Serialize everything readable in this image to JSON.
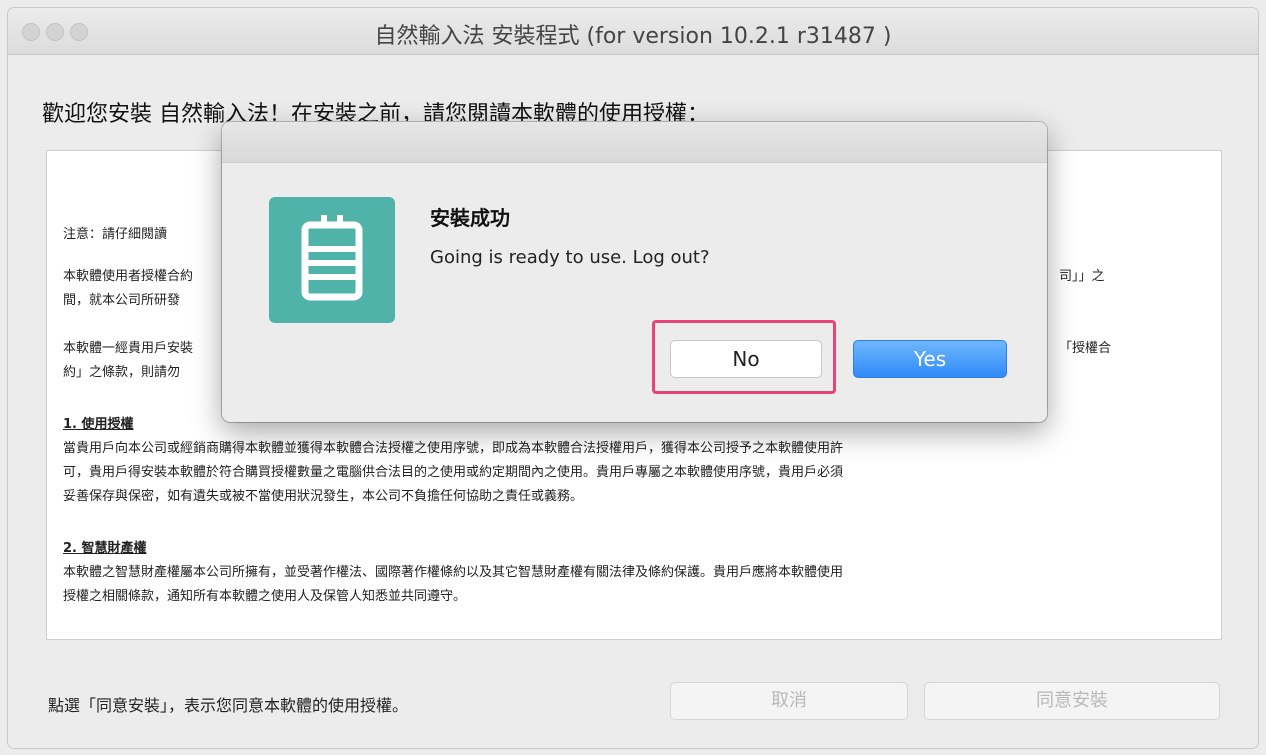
{
  "window": {
    "title": "自然輸入法 安裝程式 (for version 10.2.1 r31487 )"
  },
  "welcome": "歡迎您安裝 自然輸入法！在安裝之前，請您閱讀本軟體的使用授權：",
  "license": {
    "notice": "注意：請仔細閱讀",
    "para1_line1": "本軟體使用者授權合約",
    "para1_right": "司」」之",
    "para1_line2": "間，就本公司所研發",
    "para2_line1": "本軟體一經貴用戶安裝",
    "para2_right": "「授權合",
    "para2_line2": "約」之條款，則請勿",
    "section1_title": "1. 使用授權",
    "section1_line1": "當貴用戶向本公司或經銷商購得本軟體並獲得本軟體合法授權之使用序號，即成為本軟體合法授權用戶，獲得本公司授予之本軟體使用許",
    "section1_line2": "可，貴用戶得安裝本軟體於符合購買授權數量之電腦供合法目的之使用或約定期間內之使用。貴用戶專屬之本軟體使用序號，貴用戶必須",
    "section1_line3": "妥善保存與保密，如有遺失或被不當使用狀況發生，本公司不負擔任何協助之責任或義務。",
    "section2_title": "2. 智慧財產權",
    "section2_line1": "本軟體之智慧財產權屬本公司所擁有，並受著作權法、國際著作權條約以及其它智慧財產權有關法律及條約保護。貴用戶應將本軟體使用",
    "section2_line2": "授權之相關條款，通知所有本軟體之使用人及保管人知悉並共同遵守。"
  },
  "bottom": {
    "agree_text": "點選「同意安裝」，表示您同意本軟體的使用授權。",
    "cancel_label": "取消",
    "agree_label": "同意安裝"
  },
  "dialog": {
    "title": "安裝成功",
    "message": "Going is ready to use. Log out?",
    "no_label": "No",
    "yes_label": "Yes",
    "icon": "going-app-icon",
    "highlight_color": "#e8437a",
    "accent_color": "#2f8bf7",
    "icon_color": "#4fb3a9"
  }
}
